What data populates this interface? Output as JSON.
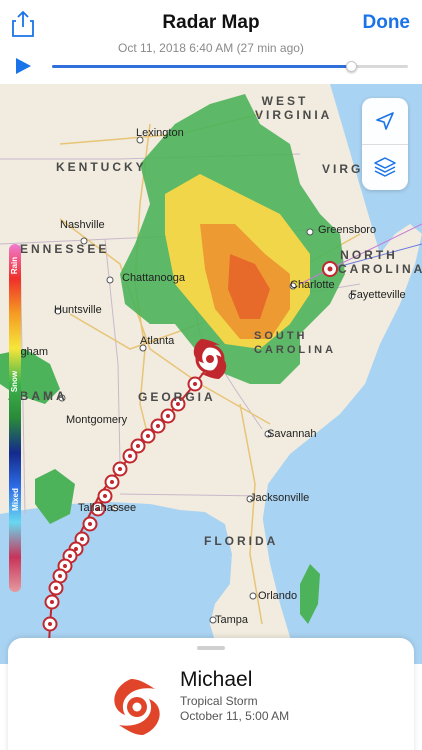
{
  "header": {
    "title": "Radar Map",
    "done_label": "Done",
    "timestamp": "Oct 11, 2018 6:40 AM (27 min ago)",
    "share_icon": "share-icon",
    "play_icon": "play-icon",
    "timeline_position": 0.84
  },
  "map": {
    "states": {
      "west_virginia": "WEST VIRGINIA",
      "kentucky": "KENTUCKY",
      "virginia": "VIRG",
      "tennessee": "ENNESSEE",
      "north_carolina": "NORTH CAROLINA",
      "south_carolina": "SOUTH CAROLINA",
      "georgia": "GEORGIA",
      "alabama": "ABAMA",
      "florida": "FLORIDA"
    },
    "cities": {
      "lexington": "Lexington",
      "nashville": "Nashville",
      "chattanooga": "Chattanooga",
      "huntsville": "Huntsville",
      "birmingham": "ingham",
      "atlanta": "Atlanta",
      "montgomery": "Montgomery",
      "greensboro": "Greensboro",
      "charlotte": "Charlotte",
      "fayetteville": "Fayetteville",
      "savannah": "Savannah",
      "tallahassee": "Tallahassee",
      "jacksonville": "Jacksonville",
      "orlando": "Orlando",
      "tampa": "Tampa"
    },
    "controls": {
      "locate_icon": "location-arrow-icon",
      "layers_icon": "layers-icon"
    },
    "legend": {
      "rain": "Rain",
      "snow": "Snow",
      "mixed": "Mixed",
      "colors": [
        "#f07ad0",
        "#f0302a",
        "#f59c23",
        "#f6e63a",
        "#3eb34a",
        "#2a8a3a",
        "#142a8c",
        "#2d6ee8",
        "#69d8f0",
        "#c8345a",
        "#e59aa0"
      ]
    }
  },
  "storm": {
    "name": "Michael",
    "type": "Tropical Storm",
    "date": "October 11, 5:00 AM",
    "icon": "hurricane-icon",
    "color": "#e0452a",
    "track_color": "#c0282e"
  }
}
